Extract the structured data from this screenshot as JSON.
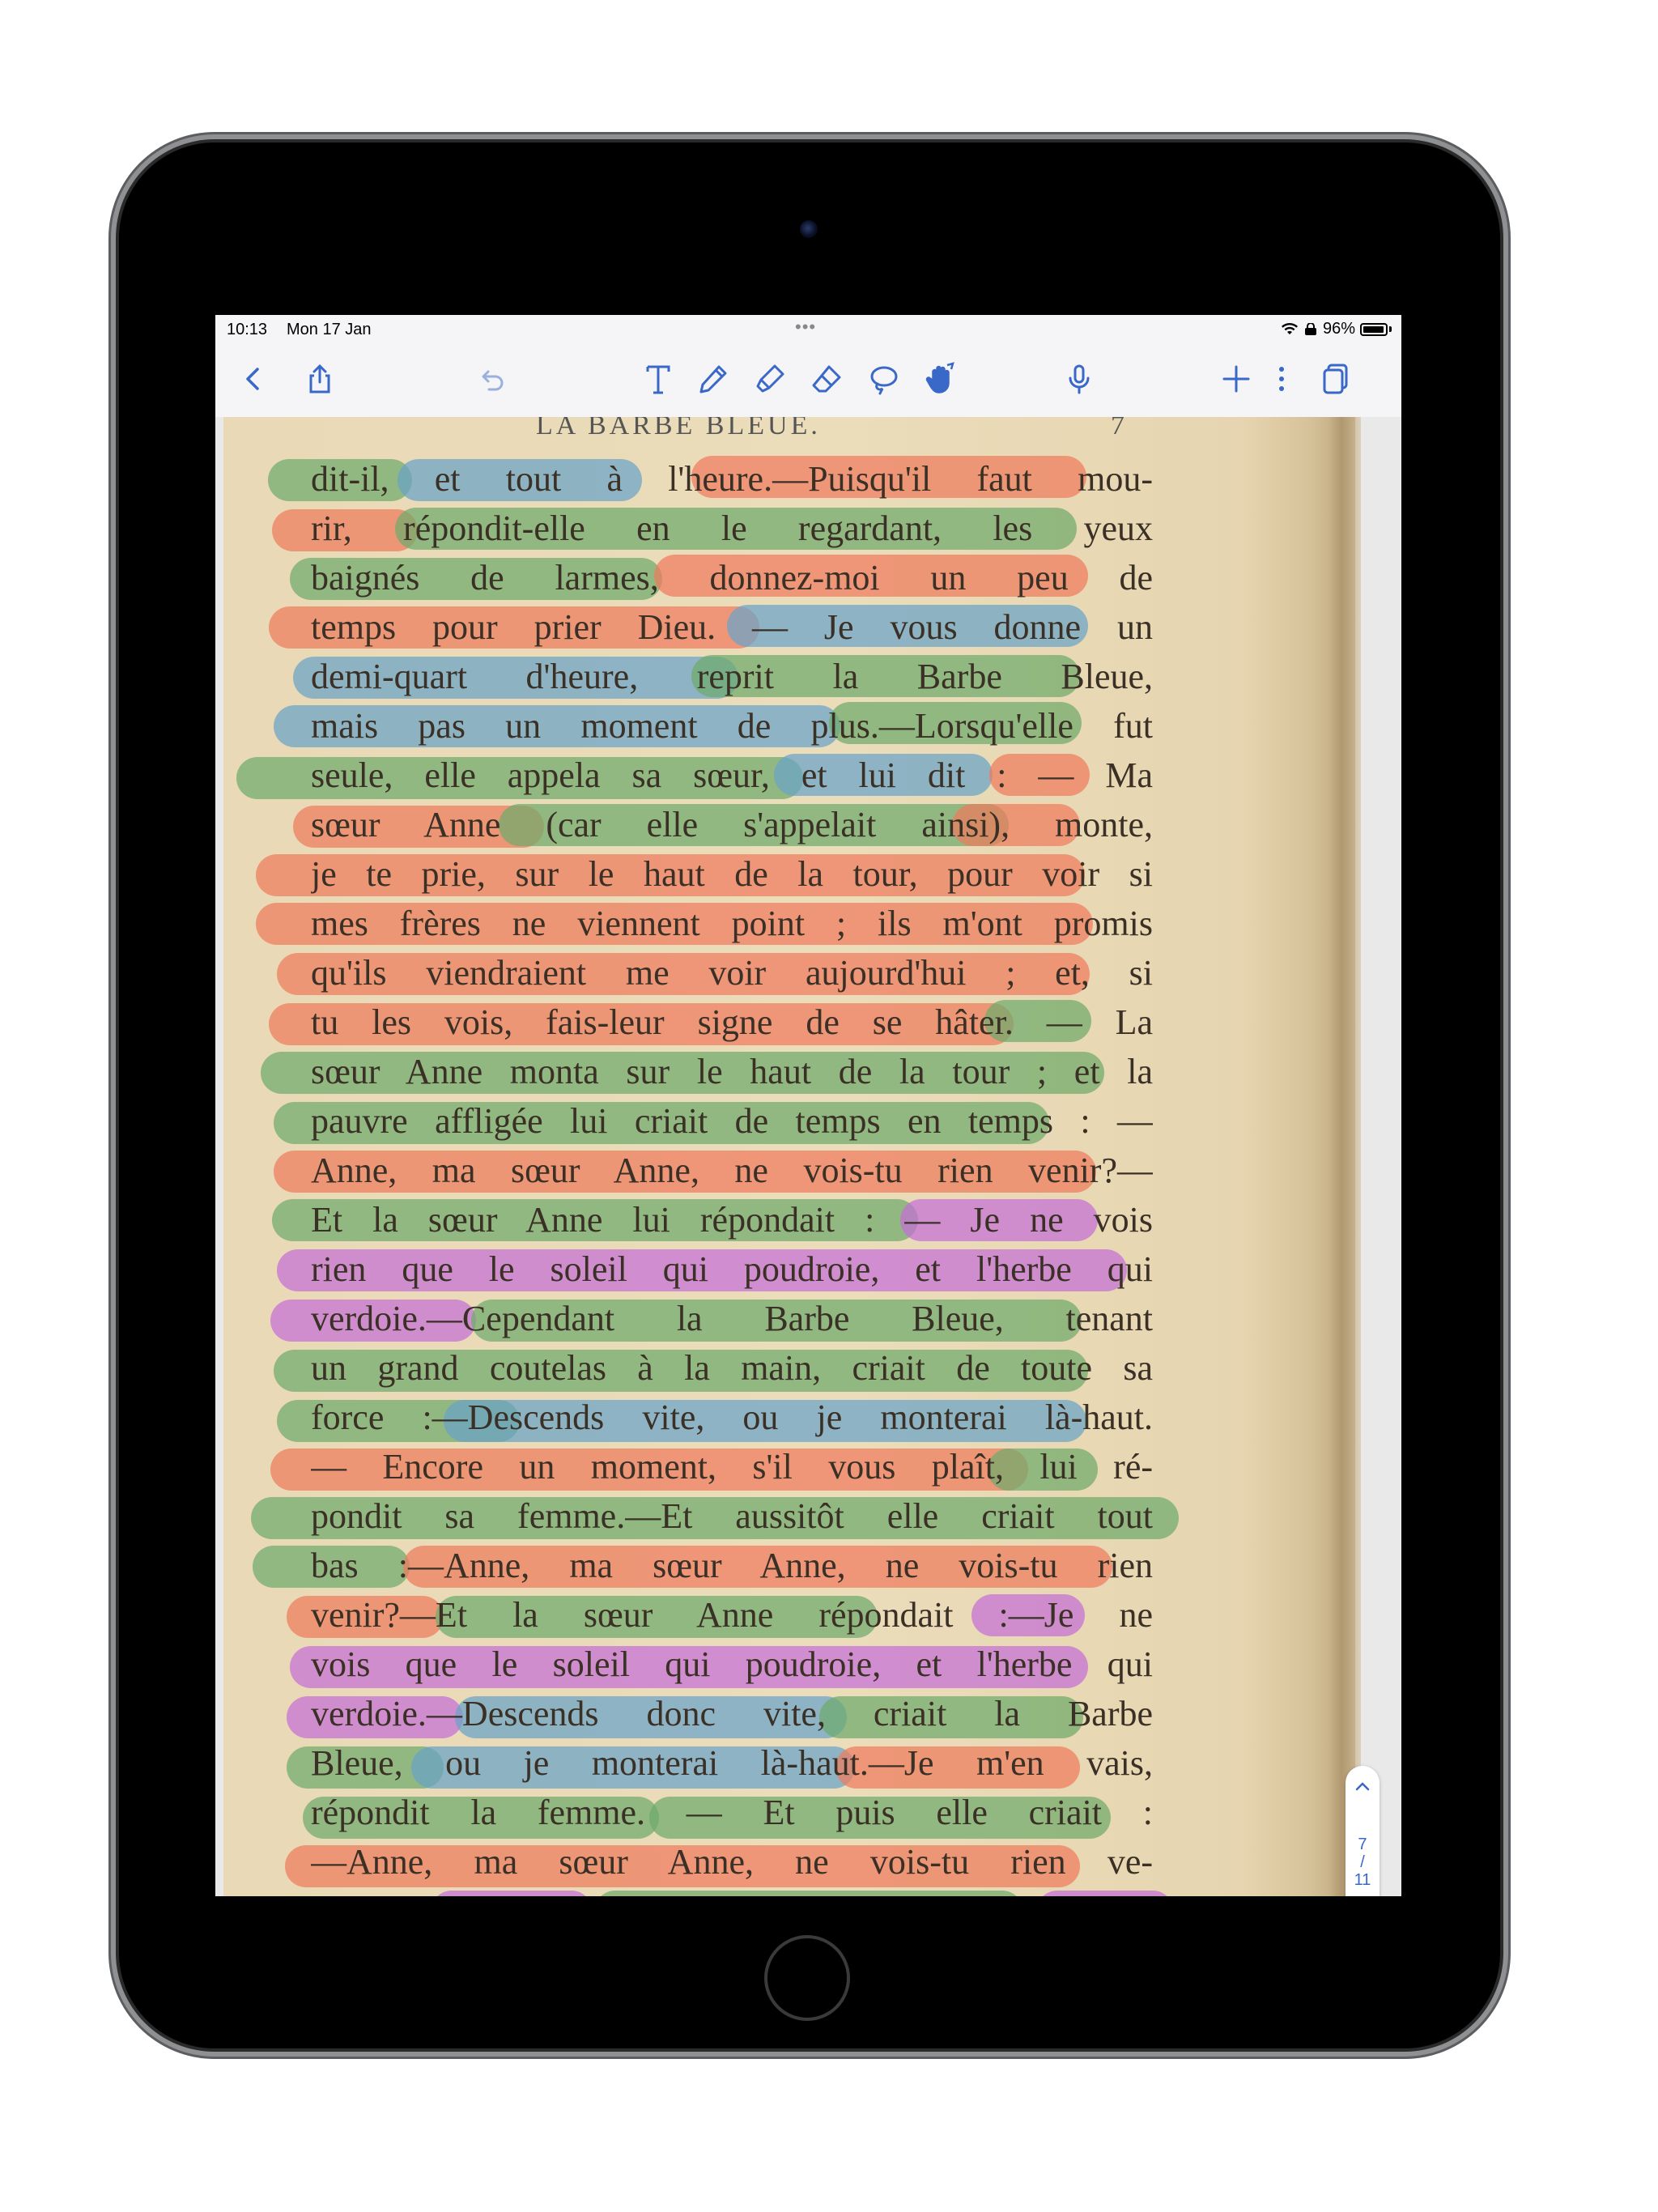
{
  "status_bar": {
    "time": "10:13",
    "date": "Mon 17 Jan",
    "battery": "96%",
    "battery_level": 0.96,
    "more_dots": "•••"
  },
  "toolbar": {
    "back_icon": "chevron-left-icon",
    "share_icon": "share-icon",
    "undo_icon": "undo-icon",
    "tools": [
      "text-tool-icon",
      "pen-icon",
      "highlighter-icon",
      "eraser-icon",
      "lasso-icon",
      "hand-tool-icon"
    ],
    "mic_icon": "microphone-icon",
    "add_icon": "plus-icon",
    "more_icon": "more-vertical-icon",
    "pages_icon": "pages-icon",
    "accent": "#3a68c8"
  },
  "page": {
    "header": "LA BARBE BLEUE.",
    "printed_number": "7",
    "lines": [
      "dit-il, et tout à l'heure.—Puisqu'il faut mou-",
      "rir, répondit-elle en le regardant, les yeux",
      "baignés de larmes, donnez-moi un peu de",
      "temps pour prier Dieu. — Je vous donne un",
      "demi-quart d'heure, reprit la Barbe Bleue,",
      "mais pas un moment de plus.—Lorsqu'elle fut",
      "seule, elle appela sa sœur, et lui dit : — Ma",
      "sœur Anne (car elle s'appelait ainsi), monte,",
      "je te prie, sur le haut de la tour, pour voir si",
      "mes frères ne viennent point ; ils m'ont promis",
      "qu'ils viendraient me voir aujourd'hui ; et, si",
      "tu les vois, fais-leur signe de se hâter. — La",
      "sœur Anne monta sur le haut de la tour ; et la",
      "pauvre affligée lui criait de temps en temps : —",
      "Anne, ma sœur Anne, ne vois-tu rien venir?—",
      "Et la sœur Anne lui répondait : — Je ne vois",
      "rien que le soleil qui poudroie, et l'herbe qui",
      "verdoie.—Cependant la Barbe Bleue, tenant",
      "un grand coutelas à la main, criait de toute sa",
      "force :—Descends vite, ou je monterai là-haut.",
      "— Encore un moment, s'il vous plaît, lui ré-",
      "pondit sa femme.—Et aussitôt elle criait tout",
      "bas :—Anne, ma sœur Anne, ne vois-tu rien",
      "venir?—Et la sœur Anne répondait :—Je ne",
      "vois que le soleil qui poudroie, et l'herbe qui",
      "verdoie.—Descends donc vite, criait la Barbe",
      "Bleue, ou je monterai là-haut.—Je m'en vais,",
      "répondit la femme. — Et puis elle criait :",
      "—Anne, ma sœur Anne, ne vois-tu rien ve-"
    ]
  },
  "highlight_colors": {
    "red": "#ee7b5d",
    "blue": "#6aa3c7",
    "green": "#6faa6b",
    "purple": "#c56fd7"
  },
  "navigator": {
    "current": "7",
    "separator": "/",
    "total": "11",
    "up_icon": "chevron-up-icon",
    "down_icon": "chevron-down-icon"
  }
}
